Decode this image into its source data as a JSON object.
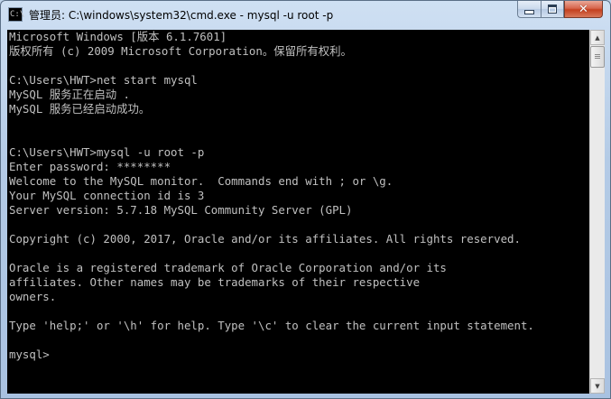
{
  "window": {
    "title": "管理员: C:\\windows\\system32\\cmd.exe - mysql  -u root -p",
    "icon": "cmd-icon",
    "icon_glyph": "C:\\"
  },
  "caption_buttons": {
    "minimize": "minimize-icon",
    "maximize": "maximize-icon",
    "close": "close-icon",
    "close_glyph": "✕"
  },
  "console": {
    "text_color": "#c0c0c0",
    "background": "#000000",
    "lines": [
      "Microsoft Windows [版本 6.1.7601]",
      "版权所有 (c) 2009 Microsoft Corporation。保留所有权利。",
      "",
      "C:\\Users\\HWT>net start mysql",
      "MySQL 服务正在启动 .",
      "MySQL 服务已经启动成功。",
      "",
      "",
      "C:\\Users\\HWT>mysql -u root -p",
      "Enter password: ********",
      "Welcome to the MySQL monitor.  Commands end with ; or \\g.",
      "Your MySQL connection id is 3",
      "Server version: 5.7.18 MySQL Community Server (GPL)",
      "",
      "Copyright (c) 2000, 2017, Oracle and/or its affiliates. All rights reserved.",
      "",
      "Oracle is a registered trademark of Oracle Corporation and/or its",
      "affiliates. Other names may be trademarks of their respective",
      "owners.",
      "",
      "Type 'help;' or '\\h' for help. Type '\\c' to clear the current input statement.",
      "",
      "mysql>"
    ]
  },
  "scrollbar": {
    "up_icon": "scroll-up-arrow-icon",
    "down_icon": "scroll-down-arrow-icon",
    "up_glyph": "▲",
    "down_glyph": "▼"
  }
}
